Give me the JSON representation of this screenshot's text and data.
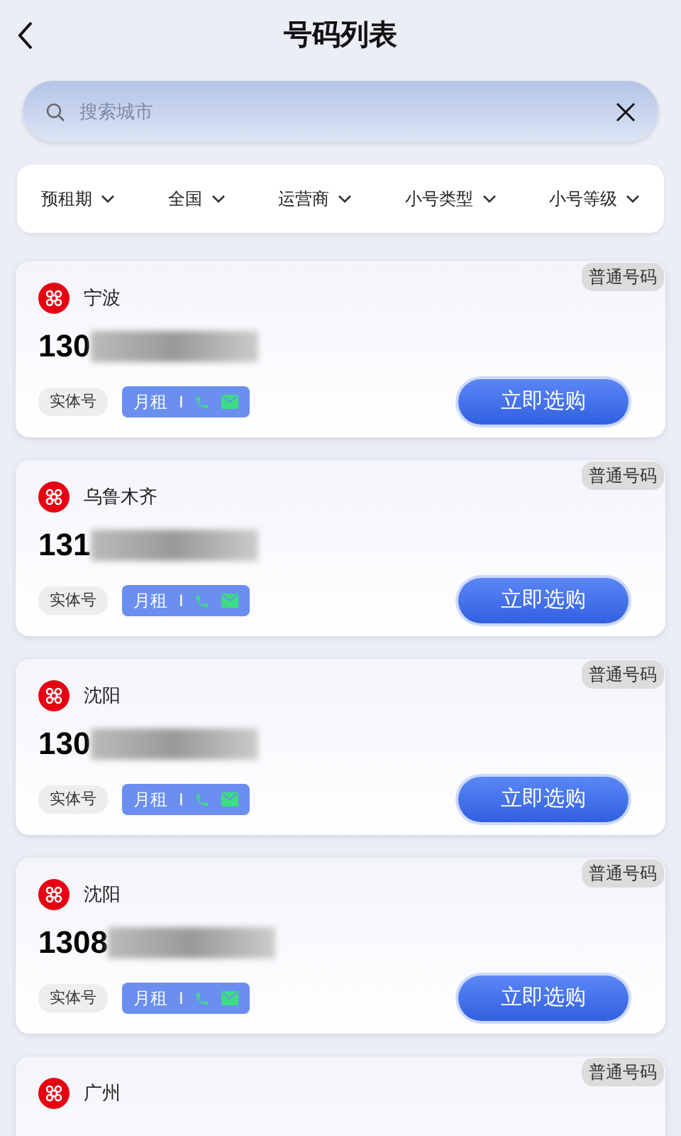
{
  "header": {
    "title": "号码列表"
  },
  "search": {
    "placeholder": "搜索城市"
  },
  "filters": [
    {
      "label": "预租期"
    },
    {
      "label": "全国"
    },
    {
      "label": "运营商"
    },
    {
      "label": "小号类型"
    },
    {
      "label": "小号等级"
    }
  ],
  "cards": [
    {
      "badge": "普通号码",
      "city": "宁波",
      "number_prefix": "130",
      "tag": "实体号",
      "rent": "月租",
      "separator": "I",
      "button": "立即选购"
    },
    {
      "badge": "普通号码",
      "city": "乌鲁木齐",
      "number_prefix": "131",
      "tag": "实体号",
      "rent": "月租",
      "separator": "I",
      "button": "立即选购"
    },
    {
      "badge": "普通号码",
      "city": "沈阳",
      "number_prefix": "130",
      "tag": "实体号",
      "rent": "月租",
      "separator": "I",
      "button": "立即选购"
    },
    {
      "badge": "普通号码",
      "city": "沈阳",
      "number_prefix": "1308",
      "tag": "实体号",
      "rent": "月租",
      "separator": "I",
      "button": "立即选购"
    },
    {
      "badge": "普通号码",
      "city": "广州"
    }
  ]
}
